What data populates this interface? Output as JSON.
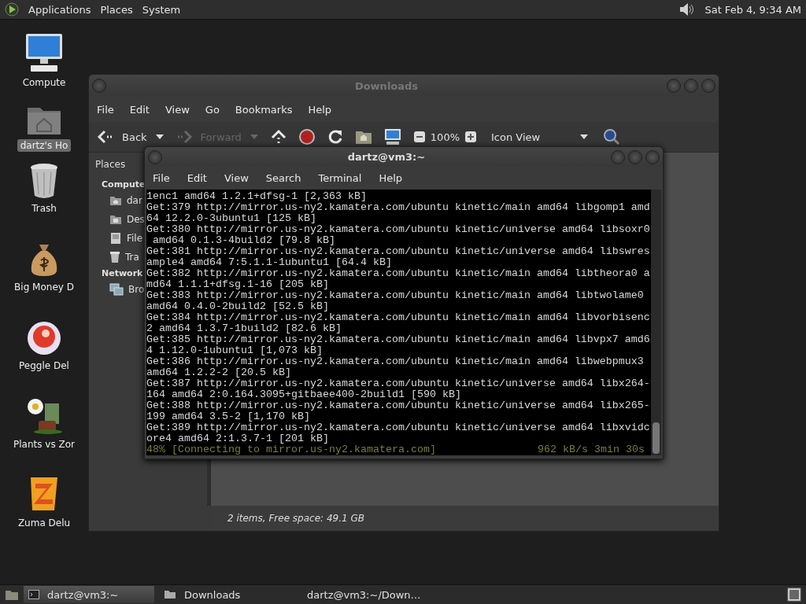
{
  "top_panel": {
    "menus": [
      "Applications",
      "Places",
      "System"
    ],
    "clock": "Sat Feb  4,  9:34 AM"
  },
  "desktop_icons": [
    {
      "label": "Compute",
      "kind": "computer",
      "selected": false
    },
    {
      "label": "dartz's Ho",
      "kind": "home",
      "selected": true
    },
    {
      "label": "Trash",
      "kind": "trash",
      "selected": false
    },
    {
      "label": "Big Money D",
      "kind": "money",
      "selected": false
    },
    {
      "label": "Peggle Del",
      "kind": "ball",
      "selected": false
    },
    {
      "label": "Plants vs Zor",
      "kind": "flower",
      "selected": false
    },
    {
      "label": "Zuma Delu",
      "kind": "block",
      "selected": false
    }
  ],
  "file_manager": {
    "title": "Downloads",
    "menus": [
      "File",
      "Edit",
      "View",
      "Go",
      "Bookmarks",
      "Help"
    ],
    "toolbar": [
      {
        "kind": "back",
        "label": "Back",
        "disabled": false
      },
      {
        "kind": "forward",
        "label": "Forward",
        "disabled": true
      },
      {
        "kind": "up",
        "disabled": false
      },
      {
        "kind": "stop",
        "disabled": false
      },
      {
        "kind": "reload",
        "disabled": false
      },
      {
        "kind": "home",
        "disabled": false
      },
      {
        "kind": "computer",
        "disabled": false
      }
    ],
    "zoom": "100%",
    "view": "Icon View",
    "sidebar": {
      "title": "Places",
      "sections": [
        {
          "heading": "Compute",
          "items": [
            {
              "label": "dar",
              "kind": "home"
            },
            {
              "label": "Des",
              "kind": "desktop"
            },
            {
              "label": "File",
              "kind": "drive"
            },
            {
              "label": "Tra",
              "kind": "trash"
            }
          ]
        },
        {
          "heading": "Network",
          "items": [
            {
              "label": "Bro",
              "kind": "network"
            }
          ]
        }
      ]
    },
    "status": "2 items, Free space: 49.1 GB"
  },
  "terminal": {
    "title": "dartz@vm3:~",
    "menus": [
      "File",
      "Edit",
      "View",
      "Search",
      "Terminal",
      "Help"
    ],
    "lines": [
      "1enc1 amd64 1.2.1+dfsg-1 [2,363 kB]",
      "Get:379 http://mirror.us-ny2.kamatera.com/ubuntu kinetic/main amd64 libgomp1 amd",
      "64 12.2.0-3ubuntu1 [125 kB]",
      "Get:380 http://mirror.us-ny2.kamatera.com/ubuntu kinetic/universe amd64 libsoxr0",
      " amd64 0.1.3-4build2 [79.8 kB]",
      "Get:381 http://mirror.us-ny2.kamatera.com/ubuntu kinetic/universe amd64 libswres",
      "ample4 amd64 7:5.1.1-1ubuntu1 [64.4 kB]",
      "Get:382 http://mirror.us-ny2.kamatera.com/ubuntu kinetic/main amd64 libtheora0 a",
      "md64 1.1.1+dfsg.1-16 [205 kB]",
      "Get:383 http://mirror.us-ny2.kamatera.com/ubuntu kinetic/main amd64 libtwolame0",
      "amd64 0.4.0-2build2 [52.5 kB]",
      "Get:384 http://mirror.us-ny2.kamatera.com/ubuntu kinetic/main amd64 libvorbisenc",
      "2 amd64 1.3.7-1build2 [82.6 kB]",
      "Get:385 http://mirror.us-ny2.kamatera.com/ubuntu kinetic/main amd64 libvpx7 amd6",
      "4 1.12.0-1ubuntu1 [1,073 kB]",
      "Get:386 http://mirror.us-ny2.kamatera.com/ubuntu kinetic/main amd64 libwebpmux3",
      "amd64 1.2.2-2 [20.5 kB]",
      "Get:387 http://mirror.us-ny2.kamatera.com/ubuntu kinetic/universe amd64 libx264-",
      "164 amd64 2:0.164.3095+gitbaee400-2build1 [590 kB]",
      "Get:388 http://mirror.us-ny2.kamatera.com/ubuntu kinetic/universe amd64 libx265-",
      "199 amd64 3.5-2 [1,170 kB]",
      "Get:389 http://mirror.us-ny2.kamatera.com/ubuntu kinetic/universe amd64 libxvidc",
      "ore4 amd64 2:1.3.7-1 [201 kB]"
    ],
    "progress_text": "48% [Connecting to mirror.us-ny2.kamatera.com]",
    "progress_rate": "962 kB/s 3min 30s"
  },
  "taskbar": [
    {
      "label": "dartz@vm3:~",
      "kind": "terminal",
      "selected": true
    },
    {
      "label": "Downloads",
      "kind": "folder",
      "selected": false
    },
    {
      "label": "dartz@vm3:~/Down…",
      "kind": "terminal",
      "selected": false
    }
  ]
}
